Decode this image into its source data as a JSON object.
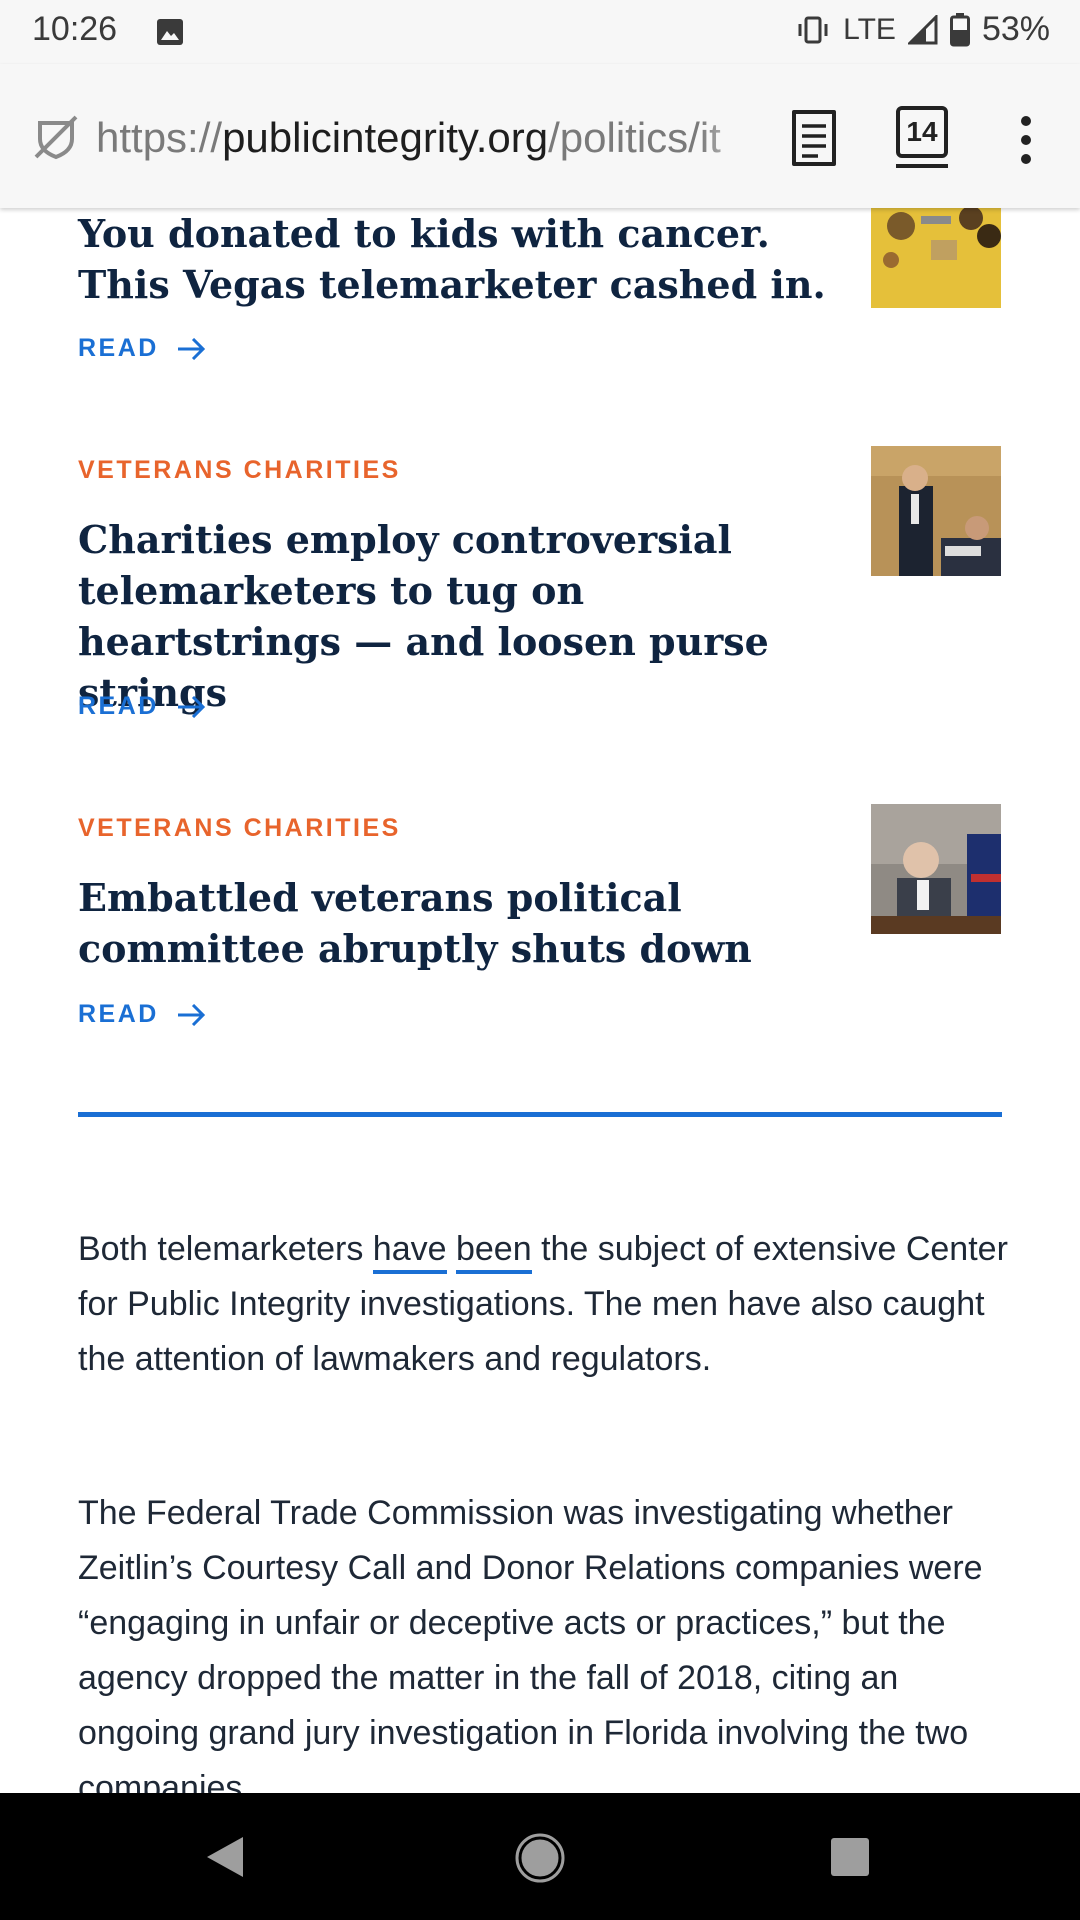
{
  "status_bar": {
    "time": "10:26",
    "network": "LTE",
    "battery": "53%"
  },
  "browser": {
    "url_scheme": "https://",
    "url_domain": "publicintegrity.org",
    "url_path": "/politics/it",
    "tab_count": "14"
  },
  "articles": [
    {
      "title": "You donated to kids with cancer. This Vegas telemarketer cashed in.",
      "read_label": "READ"
    },
    {
      "kicker": "VETERANS CHARITIES",
      "title": "Charities employ controversial telemarketers to tug on heartstrings — and loosen purse strings",
      "read_label": "READ"
    },
    {
      "kicker": "VETERANS CHARITIES",
      "title": "Embattled veterans political committee abruptly shuts down",
      "read_label": "READ"
    }
  ],
  "body": {
    "p1_before": "Both telemarketers ",
    "p1_link1": "have",
    "p1_space": " ",
    "p1_link2": "been",
    "p1_after": " the subject of extensive Center for Public Integrity investigations. The men have also caught the attention of lawmakers and regulators.",
    "p2": "The Federal Trade Commission was investigating whether Zeitlin’s Courtesy Call and Donor Relations companies were “engaging in unfair or deceptive acts or practices,” but the agency dropped the matter in the fall of 2018, citing an ongoing grand jury investigation in Florida involving the two companies."
  },
  "colors": {
    "kicker": "#e8642c",
    "link": "#1a6fd4",
    "headline": "#0f2440"
  }
}
